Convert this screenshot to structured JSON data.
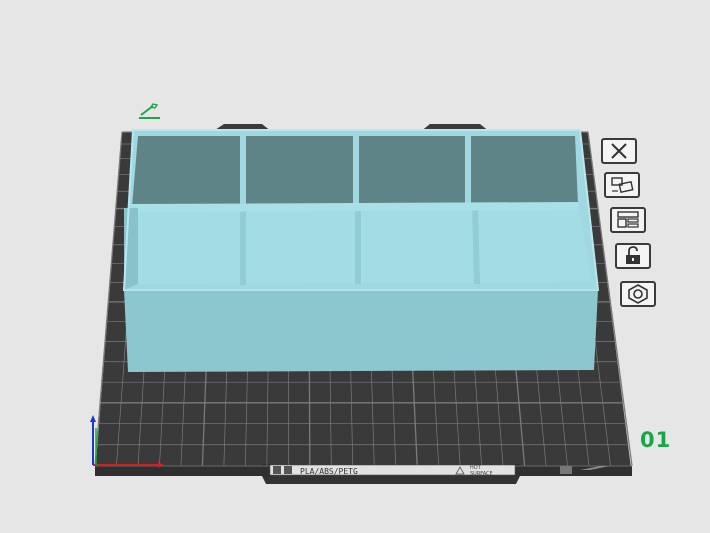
{
  "viewport": {
    "background_color": "#e6e6e6",
    "bed_color": "#3a3a3a",
    "grid_color": "#7b7b7b",
    "model_top_color": "#9fd8e0",
    "model_side_color": "#8cc6cf",
    "model_inner_color": "#5f8488"
  },
  "plate": {
    "number": "01",
    "material_label": "PLA/ABS/PETG",
    "surface_label_line1": "HOT",
    "surface_label_line2": "SURFACE"
  },
  "toolbar": {
    "buttons": [
      {
        "icon": "close-icon"
      },
      {
        "icon": "arrange-icon"
      },
      {
        "icon": "plate-layers-icon"
      },
      {
        "icon": "unlock-icon"
      },
      {
        "icon": "plate-settings-icon"
      }
    ]
  },
  "axes": {
    "x_color": "#d42020",
    "y_color": "#1a3acc",
    "z_color": "#1aa54a"
  }
}
